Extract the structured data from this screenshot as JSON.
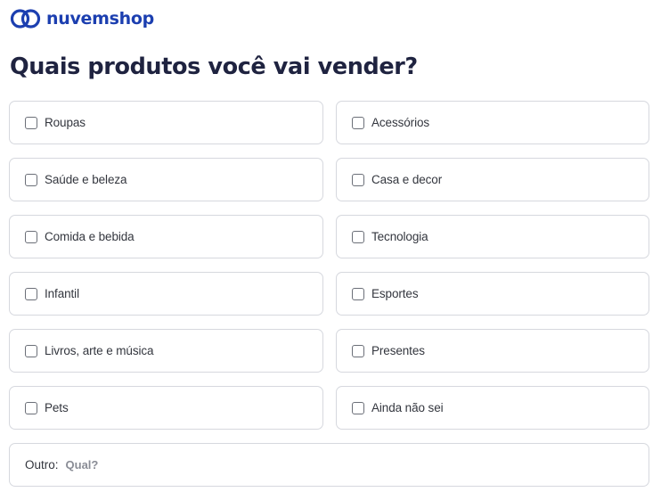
{
  "brand": {
    "name": "nuvemshop",
    "logo_icon": "nuvemshop-cloud-icon",
    "color": "#1c3fb0"
  },
  "page": {
    "title": "Quais produtos você vai vender?"
  },
  "options": [
    {
      "label": "Roupas",
      "checked": false
    },
    {
      "label": "Acessórios",
      "checked": false
    },
    {
      "label": "Saúde e beleza",
      "checked": false
    },
    {
      "label": "Casa e decor",
      "checked": false
    },
    {
      "label": "Comida e bebida",
      "checked": false
    },
    {
      "label": "Tecnologia",
      "checked": false
    },
    {
      "label": "Infantil",
      "checked": false
    },
    {
      "label": "Esportes",
      "checked": false
    },
    {
      "label": "Livros, arte e música",
      "checked": false
    },
    {
      "label": "Presentes",
      "checked": false
    },
    {
      "label": "Pets",
      "checked": false
    },
    {
      "label": "Ainda não sei",
      "checked": false
    }
  ],
  "other": {
    "label": "Outro:",
    "value": "",
    "placeholder": "Qual?"
  },
  "colors": {
    "title": "#1f2340",
    "border": "#d6d8de",
    "text": "#33363e"
  }
}
